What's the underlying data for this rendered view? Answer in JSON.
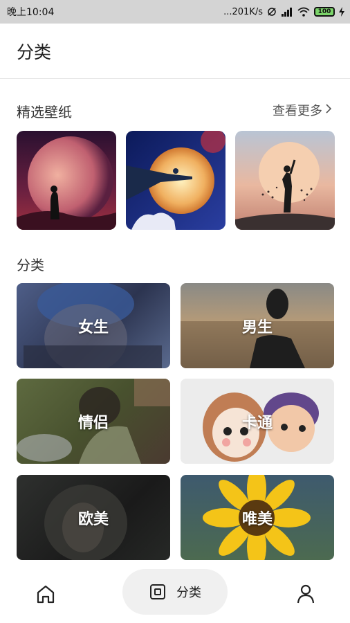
{
  "status_bar": {
    "time": "晚上10:04",
    "network_speed": "...201K/s",
    "battery": "100"
  },
  "app_bar": {
    "title": "分类"
  },
  "featured": {
    "title": "精选壁纸",
    "more_label": "查看更多",
    "items": [
      {
        "icon": "moon-silhouette-thumbnail"
      },
      {
        "icon": "fullmoon-cliff-thumbnail"
      },
      {
        "icon": "sunset-silhouette-thumbnail"
      }
    ]
  },
  "categories": {
    "title": "分类",
    "items": [
      {
        "label": "女生"
      },
      {
        "label": "男生"
      },
      {
        "label": "情侣"
      },
      {
        "label": "卡通"
      },
      {
        "label": "欧美"
      },
      {
        "label": "唯美"
      }
    ]
  },
  "bottom_nav": {
    "items": [
      {
        "icon": "home-icon"
      },
      {
        "icon": "category-icon",
        "label": "分类",
        "active": true
      },
      {
        "icon": "user-icon"
      }
    ]
  }
}
